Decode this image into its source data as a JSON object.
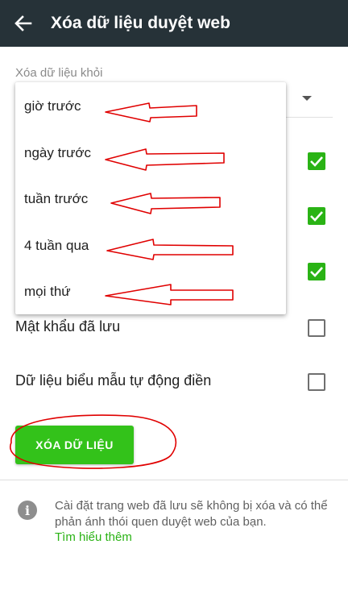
{
  "appbar": {
    "title": "Xóa dữ liệu duyệt web",
    "back_icon": "arrow-back-icon",
    "background": "#263238"
  },
  "clear_from": {
    "label": "Xóa dữ liệu khỏi",
    "arrow_icon": "dropdown-arrow-icon"
  },
  "dropdown": {
    "options": [
      {
        "label": "giờ trước"
      },
      {
        "label": "ngày trước"
      },
      {
        "label": "tuần trước"
      },
      {
        "label": "4 tuần qua"
      },
      {
        "label": "mọi thứ"
      }
    ]
  },
  "checkboxes": [
    {
      "label": "",
      "checked": true
    },
    {
      "label": "",
      "checked": true
    },
    {
      "label": "",
      "checked": true
    },
    {
      "label": "Mật khẩu đã lưu",
      "checked": false
    },
    {
      "label": "Dữ liệu biểu mẫu tự động điền",
      "checked": false
    }
  ],
  "clear_button": {
    "label": "XÓA DỮ LIỆU"
  },
  "footer": {
    "info_icon": "info-icon",
    "info_glyph": "i",
    "note": "Cài đặt trang web đã lưu sẽ không bị xóa và có thể phản ánh thói quen duyệt web của bạn.",
    "learn_more": "Tìm hiểu thêm"
  },
  "colors": {
    "accent_green": "#2ab315",
    "button_green": "#33c21a",
    "annotation_red": "#e00000"
  }
}
